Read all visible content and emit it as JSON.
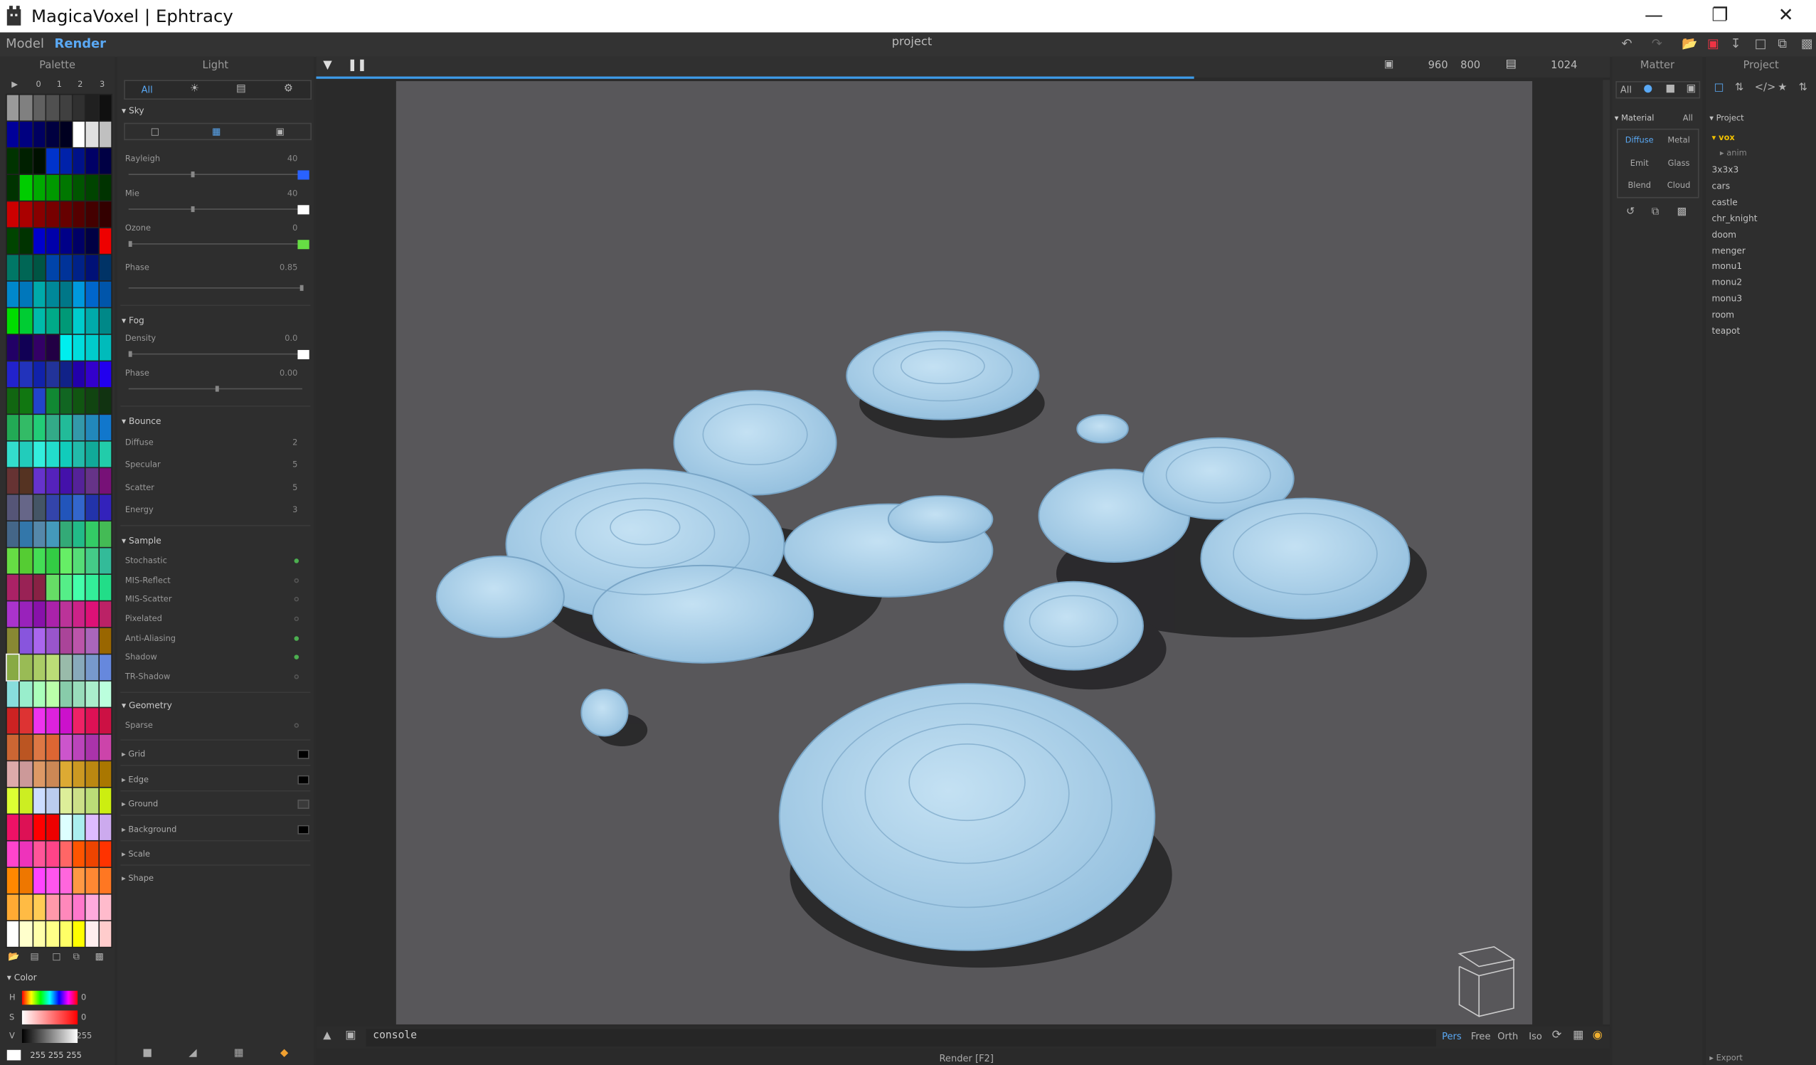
{
  "app": {
    "title": "MagicaVoxel | Ephtracy",
    "project_title": "project"
  },
  "menu": {
    "model": "Model",
    "render": "Render"
  },
  "palette": {
    "header": "Palette",
    "columns": [
      "▶",
      "0",
      "1",
      "2",
      "3"
    ],
    "colors": [
      "#9a9a9a",
      "#808080",
      "#606060",
      "#505050",
      "#404040",
      "#303030",
      "#202020",
      "#101010",
      "#000099",
      "#000080",
      "#000060",
      "#000040",
      "#000020",
      "#ffffff",
      "#e0e0e0",
      "#c0c0c0",
      "#003300",
      "#002000",
      "#001000",
      "#0033cc",
      "#0022aa",
      "#001188",
      "#000066",
      "#000044",
      "#003300",
      "#00cc00",
      "#00aa00",
      "#009900",
      "#007700",
      "#005500",
      "#004400",
      "#003300",
      "#cc0000",
      "#aa0000",
      "#880000",
      "#770000",
      "#660000",
      "#550000",
      "#440000",
      "#330000",
      "#004400",
      "#003300",
      "#0000cc",
      "#0000aa",
      "#000088",
      "#000066",
      "#000044",
      "#ee0000",
      "#007766",
      "#006655",
      "#005544",
      "#0044aa",
      "#003399",
      "#002288",
      "#001177",
      "#003366",
      "#0088cc",
      "#0077bb",
      "#00aaaa",
      "#008899",
      "#007788",
      "#0099dd",
      "#0066cc",
      "#0055aa",
      "#00dd00",
      "#00cc33",
      "#00bbaa",
      "#00aa88",
      "#009977",
      "#00cccc",
      "#00aaaa",
      "#008888",
      "#220066",
      "#110055",
      "#330066",
      "#220044",
      "#00eeee",
      "#00dddd",
      "#00cccc",
      "#00bbbb",
      "#2222cc",
      "#2233bb",
      "#1122aa",
      "#223399",
      "#112288",
      "#2200aa",
      "#3300cc",
      "#2200ee",
      "#116611",
      "#117711",
      "#2244cc",
      "#118833",
      "#116622",
      "#115511",
      "#114411",
      "#113311",
      "#22aa55",
      "#33bb66",
      "#22cc77",
      "#33aa88",
      "#22bb99",
      "#3399aa",
      "#2288bb",
      "#1177cc",
      "#33ddcc",
      "#22ccbb",
      "#33eedd",
      "#22ddcc",
      "#11ccbb",
      "#22bbaa",
      "#11aa99",
      "#22ccaa",
      "#663333",
      "#553322",
      "#6633cc",
      "#5522bb",
      "#4411aa",
      "#552299",
      "#663388",
      "#771177",
      "#555577",
      "#666688",
      "#445566",
      "#3344aa",
      "#2255bb",
      "#3366cc",
      "#2233aa",
      "#3322bb",
      "#446688",
      "#3377aa",
      "#5588aa",
      "#4499bb",
      "#33aa77",
      "#22bb88",
      "#33cc66",
      "#44bb55",
      "#66dd44",
      "#55cc33",
      "#44dd55",
      "#33cc44",
      "#66ee66",
      "#55dd77",
      "#44cc88",
      "#33bb99",
      "#aa2266",
      "#992255",
      "#882244",
      "#66dd66",
      "#55ee88",
      "#44ffaa",
      "#33ee99",
      "#22dd88",
      "#aa33cc",
      "#9922bb",
      "#8811aa",
      "#aa22aa",
      "#bb3399",
      "#cc2288",
      "#dd1177",
      "#bb2266",
      "#888833",
      "#8855dd",
      "#aa66ee",
      "#9955cc",
      "#aa4499",
      "#bb55aa",
      "#aa66bb",
      "#996600",
      "#88aa44",
      "#99bb55",
      "#aacc66",
      "#bbdd77",
      "#99bbaa",
      "#88aabb",
      "#7799cc",
      "#6688dd",
      "#88dddd",
      "#99eecc",
      "#aaffbb",
      "#bbffaa",
      "#88ccaa",
      "#99ddbb",
      "#aaeecc",
      "#bbffdd",
      "#cc2222",
      "#dd3333",
      "#ee33ee",
      "#dd22dd",
      "#cc11cc",
      "#ee2266",
      "#dd1155",
      "#cc1144",
      "#cc6633",
      "#bb5522",
      "#dd7744",
      "#dd6633",
      "#cc55cc",
      "#bb44bb",
      "#aa33aa",
      "#cc44aa",
      "#ddaaaa",
      "#cc9999",
      "#dd9966",
      "#cc8855",
      "#ddaa33",
      "#cc9922",
      "#bb8811",
      "#aa7700",
      "#ddff33",
      "#ccee22",
      "#ccddff",
      "#bbccee",
      "#ddee99",
      "#cce088",
      "#bbdd77",
      "#ccee11",
      "#ee1166",
      "#dd1155",
      "#ff0000",
      "#ee0000",
      "#ddffff",
      "#aaeeee",
      "#ddbbff",
      "#ccaaee",
      "#ff44cc",
      "#ee33bb",
      "#ff5599",
      "#ff4488",
      "#ff6666",
      "#ff5500",
      "#ee4400",
      "#ff3300",
      "#ff8800",
      "#ee7700",
      "#ff44ff",
      "#ff55ee",
      "#ff66dd",
      "#ff9944",
      "#ff8833",
      "#ff7722",
      "#ffaa33",
      "#ffbb44",
      "#ffcc55",
      "#ff99aa",
      "#ff88bb",
      "#ff77cc",
      "#ffaadd",
      "#ffbbcc",
      "#ffffff",
      "#ffffcc",
      "#ffffaa",
      "#ffff88",
      "#ffff66",
      "#ffff00",
      "#ffeeee",
      "#ffcccc"
    ],
    "color_section": "Color",
    "h": "H",
    "s": "S",
    "v": "V",
    "h_val": "0",
    "s_val": "0",
    "v_val": "255",
    "rgb": "255  255  255"
  },
  "light": {
    "header": "Light",
    "tabs": {
      "all": "All"
    },
    "sky": "Sky",
    "rayleigh": "Rayleigh",
    "rayleigh_val": "40",
    "mie": "Mie",
    "mie_val": "40",
    "ozone": "Ozone",
    "ozone_val": "0",
    "phase": "Phase",
    "phase_val": "0.85",
    "fog": "Fog",
    "density": "Density",
    "density_val": "0.0",
    "fog_phase": "Phase",
    "fog_phase_val": "0.00",
    "bounce": "Bounce",
    "diffuse": "Diffuse",
    "diffuse_val": "2",
    "specular": "Specular",
    "specular_val": "5",
    "scatter": "Scatter",
    "scatter_val": "5",
    "energy": "Energy",
    "energy_val": "3",
    "sample": "Sample",
    "stochastic": "Stochastic",
    "mis_reflect": "MIS-Reflect",
    "mis_scatter": "MIS-Scatter",
    "pixelated": "Pixelated",
    "anti_aliasing": "Anti-Aliasing",
    "shadow": "Shadow",
    "tr_shadow": "TR-Shadow",
    "geometry": "Geometry",
    "sparse": "Sparse",
    "grid": "Grid",
    "edge": "Edge",
    "ground": "Ground",
    "background": "Background",
    "scale": "Scale",
    "shape": "Shape",
    "colors": {
      "rayleigh": "#2962ff",
      "ozone": "#66dd44",
      "white": "#ffffff",
      "black": "#000000"
    }
  },
  "viewport": {
    "width": "960",
    "height": "800",
    "samples": "1024",
    "console": "console",
    "status": "Render [F2]",
    "views": {
      "pers": "Pers",
      "free": "Free",
      "orth": "Orth",
      "iso": "Iso"
    },
    "voxel_color": "#a8cfe8",
    "bg_color": "#58575a"
  },
  "matter": {
    "header": "Matter",
    "all": "All",
    "material": "Material",
    "material_all": "All",
    "types": {
      "diffuse": "Diffuse",
      "metal": "Metal",
      "emit": "Emit",
      "glass": "Glass",
      "blend": "Blend",
      "cloud": "Cloud"
    }
  },
  "project": {
    "header": "Project",
    "root": "Project",
    "folder": "vox",
    "sub": "anim",
    "files": [
      "3x3x3",
      "cars",
      "castle",
      "chr_knight",
      "doom",
      "menger",
      "monu1",
      "monu2",
      "monu3",
      "room",
      "teapot"
    ],
    "export": "Export"
  }
}
